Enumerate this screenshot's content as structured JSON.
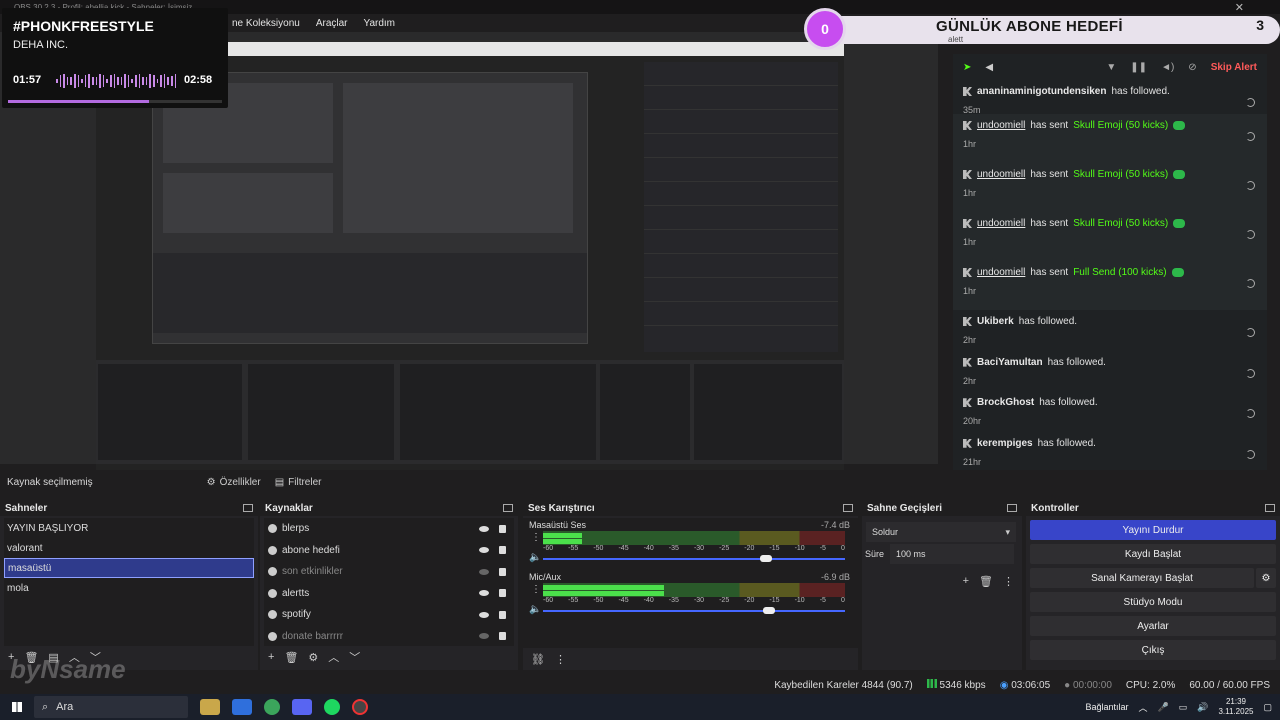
{
  "window": {
    "title": "OBS 30.2.3 - Profil: ahellia kick - Sahneler: İsimsiz",
    "close_icon": "close-icon"
  },
  "menu": [
    "ne Koleksiyonu",
    "Araçlar",
    "Yardım"
  ],
  "music": {
    "song": "#PHONKFREESTYLE",
    "artist": "DEHA INC.",
    "elapsed": "01:57",
    "total": "02:58",
    "progress": 0.66
  },
  "goal": {
    "current": "0",
    "title": "GÜNLÜK ABONE HEDEFİ",
    "target": "3",
    "subtitle": "alett"
  },
  "alerts": {
    "skip_label": "Skip Alert",
    "items": [
      {
        "user": "ananinaminigotundensiken",
        "text": "has followed.",
        "reward": "",
        "time": "35m",
        "coin": false,
        "underline": false
      },
      {
        "user": "undoomiell",
        "text": "has sent",
        "reward": "Skull Emoji (50 kicks)",
        "time": "1hr",
        "coin": true,
        "underline": true
      },
      {
        "user": "undoomiell",
        "text": "has sent",
        "reward": "Skull Emoji (50 kicks)",
        "time": "1hr",
        "coin": true,
        "underline": true
      },
      {
        "user": "undoomiell",
        "text": "has sent",
        "reward": "Skull Emoji (50 kicks)",
        "time": "1hr",
        "coin": true,
        "underline": true
      },
      {
        "user": "undoomiell",
        "text": "has sent",
        "reward": "Full Send (100 kicks)",
        "time": "1hr",
        "coin": true,
        "underline": true
      },
      {
        "user": "Ukiberk",
        "text": "has followed.",
        "reward": "",
        "time": "2hr",
        "coin": false,
        "underline": false
      },
      {
        "user": "BaciYamultan",
        "text": "has followed.",
        "reward": "",
        "time": "2hr",
        "coin": false,
        "underline": false
      },
      {
        "user": "BrockGhost",
        "text": "has followed.",
        "reward": "",
        "time": "20hr",
        "coin": false,
        "underline": false
      },
      {
        "user": "kerempiges",
        "text": "has followed.",
        "reward": "",
        "time": "21hr",
        "coin": false,
        "underline": false
      }
    ]
  },
  "source_bar": {
    "status": "Kaynak seçilmemiş",
    "properties": "Özellikler",
    "filters": "Filtreler"
  },
  "scenes": {
    "title": "Sahneler",
    "items": [
      "YAYIN BAŞLIYOR",
      "valorant",
      "masaüstü",
      "mola"
    ],
    "selected": 2
  },
  "sources": {
    "title": "Kaynaklar",
    "items": [
      {
        "name": "blerps",
        "visible": true
      },
      {
        "name": "abone hedefi",
        "visible": true
      },
      {
        "name": "son etkinlikler",
        "visible": false
      },
      {
        "name": "alertts",
        "visible": true
      },
      {
        "name": "spotify",
        "visible": true
      },
      {
        "name": "donate barrrrr",
        "visible": false
      }
    ]
  },
  "mixer": {
    "title": "Ses Karıştırıcı",
    "channels": [
      {
        "name": "Masaüstü Ses",
        "db": "-7.4 dB",
        "level": 0.13,
        "volume": 0.72
      },
      {
        "name": "Mic/Aux",
        "db": "-6.9 dB",
        "level": 0.4,
        "volume": 0.73
      }
    ],
    "ticks": [
      "-60",
      "-55",
      "-50",
      "-45",
      "-40",
      "-35",
      "-30",
      "-25",
      "-20",
      "-15",
      "-10",
      "-5",
      "0"
    ]
  },
  "transitions": {
    "title": "Sahne Geçişleri",
    "selected": "Soldur",
    "duration_label": "Süre",
    "duration": "100 ms"
  },
  "controls": {
    "title": "Kontroller",
    "buttons": [
      "Yayını Durdur",
      "Kaydı Başlat",
      "Sanal Kamerayı Başlat",
      "Stüdyo Modu",
      "Ayarlar",
      "Çıkış"
    ]
  },
  "status": {
    "dropped": "Kaybedilen Kareler 4844 (90.7)",
    "bitrate": "5346 kbps",
    "stream_time": "03:06:05",
    "rec_time": "00:00:00",
    "cpu": "CPU: 2.0%",
    "fps": "60.00 / 60.00 FPS"
  },
  "taskbar": {
    "search_placeholder": "Ara",
    "network_label": "Bağlantılar",
    "time": "21:39",
    "date": "3.11.2025"
  },
  "watermark": "byNsame"
}
